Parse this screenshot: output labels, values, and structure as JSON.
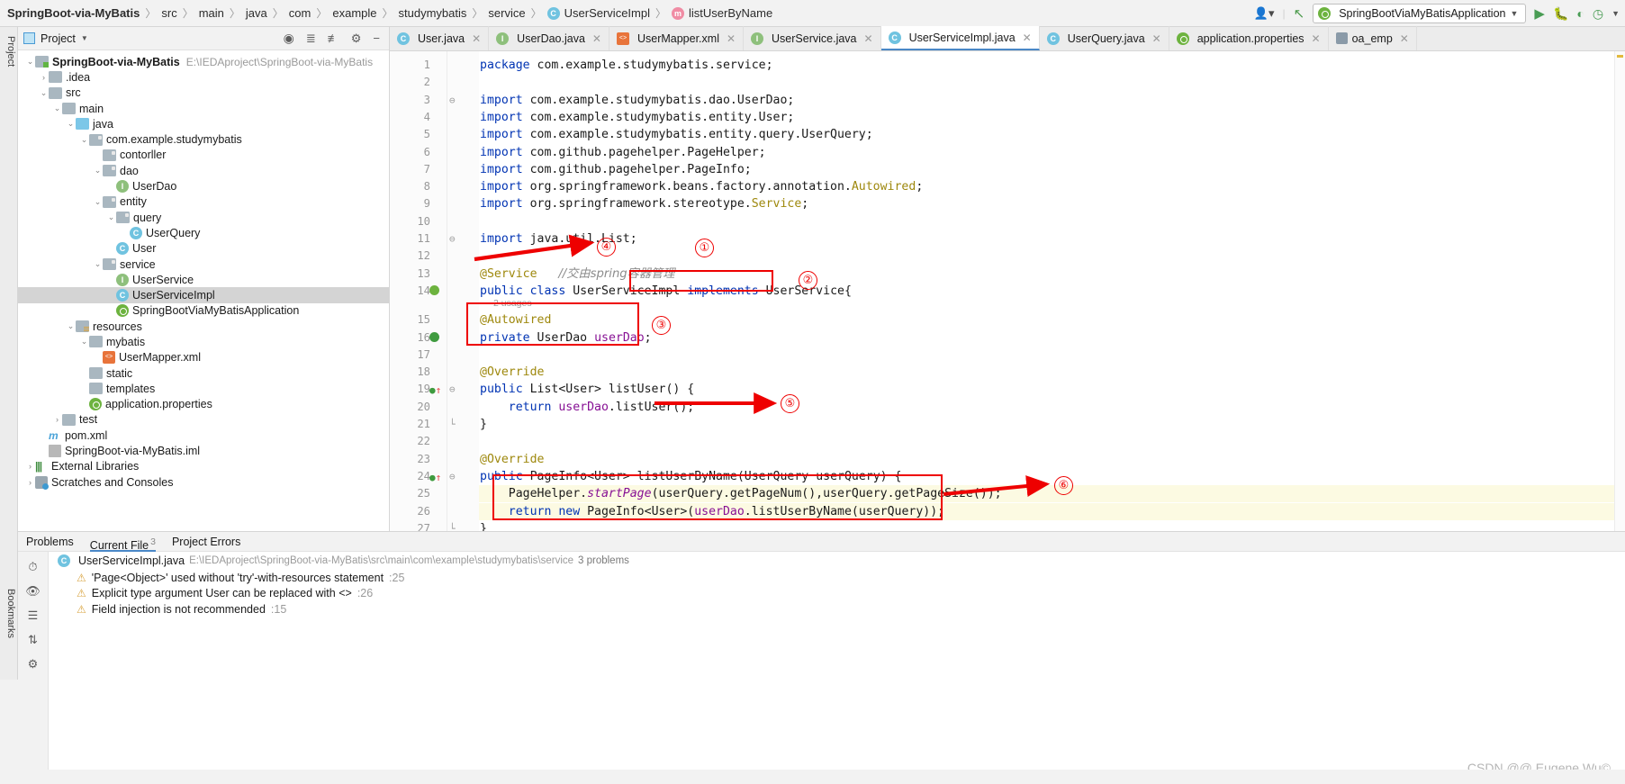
{
  "app": {
    "breadcrumb": [
      {
        "label": "SpringBoot-via-MyBatis",
        "icon": "none",
        "bold": true
      },
      {
        "label": "src",
        "icon": "none",
        "bold": false
      },
      {
        "label": "main",
        "icon": "none",
        "bold": false
      },
      {
        "label": "java",
        "icon": "none",
        "bold": false
      },
      {
        "label": "com",
        "icon": "none",
        "bold": false
      },
      {
        "label": "example",
        "icon": "none",
        "bold": false
      },
      {
        "label": "studymybatis",
        "icon": "none",
        "bold": false
      },
      {
        "label": "service",
        "icon": "none",
        "bold": false
      },
      {
        "label": "UserServiceImpl",
        "icon": "class-badge",
        "bold": false
      },
      {
        "label": "listUserByName",
        "icon": "method-badge",
        "bold": false
      }
    ],
    "toolbar": {
      "profile_icon": "user-icon",
      "back_icon": "arrow-up-left-icon",
      "run_config": "SpringBootViaMyBatisApplication",
      "run_config_icon": "spring-icon",
      "dropdown_icon": "chevron-down-icon",
      "run_icon": "run-triangle-icon",
      "debug_icon": "debug-bug-icon",
      "coverage_icon": "run-with-coverage-icon",
      "profiler_icon": "profiler-icon",
      "more_icon": "chevron-down-icon"
    }
  },
  "left_strip": {
    "project_tab": "Project",
    "bookmarks_tab": "Bookmarks"
  },
  "project_panel": {
    "title": "Project",
    "dropdown_icon": "chevron-down-icon",
    "tools": [
      "locate-icon",
      "expand-all-icon",
      "collapse-all-icon",
      "gear-icon",
      "hide-icon"
    ],
    "tree": [
      {
        "label": "SpringBoot-via-MyBatis",
        "path": "E:\\IEDAproject\\SpringBoot-via-MyBatis",
        "depth": 0,
        "arrow": "down",
        "icon": "module-folder",
        "bold": true,
        "selected": false
      },
      {
        "label": ".idea",
        "path": "",
        "depth": 1,
        "arrow": "right",
        "icon": "folder",
        "bold": false,
        "selected": false
      },
      {
        "label": "src",
        "path": "",
        "depth": 1,
        "arrow": "down",
        "icon": "folder",
        "bold": false,
        "selected": false
      },
      {
        "label": "main",
        "path": "",
        "depth": 2,
        "arrow": "down",
        "icon": "folder",
        "bold": false,
        "selected": false
      },
      {
        "label": "java",
        "path": "",
        "depth": 3,
        "arrow": "down",
        "icon": "source-folder",
        "bold": false,
        "selected": false
      },
      {
        "label": "com.example.studymybatis",
        "path": "",
        "depth": 4,
        "arrow": "down",
        "icon": "package",
        "bold": false,
        "selected": false
      },
      {
        "label": "contorller",
        "path": "",
        "depth": 5,
        "arrow": "none",
        "icon": "package",
        "bold": false,
        "selected": false
      },
      {
        "label": "dao",
        "path": "",
        "depth": 5,
        "arrow": "down",
        "icon": "package",
        "bold": false,
        "selected": false
      },
      {
        "label": "UserDao",
        "path": "",
        "depth": 6,
        "arrow": "none",
        "icon": "interface-badge",
        "bold": false,
        "selected": false
      },
      {
        "label": "entity",
        "path": "",
        "depth": 5,
        "arrow": "down",
        "icon": "package",
        "bold": false,
        "selected": false
      },
      {
        "label": "query",
        "path": "",
        "depth": 6,
        "arrow": "down",
        "icon": "package",
        "bold": false,
        "selected": false
      },
      {
        "label": "UserQuery",
        "path": "",
        "depth": 7,
        "arrow": "none",
        "icon": "class-badge",
        "bold": false,
        "selected": false
      },
      {
        "label": "User",
        "path": "",
        "depth": 6,
        "arrow": "none",
        "icon": "class-badge",
        "bold": false,
        "selected": false
      },
      {
        "label": "service",
        "path": "",
        "depth": 5,
        "arrow": "down",
        "icon": "package",
        "bold": false,
        "selected": false
      },
      {
        "label": "UserService",
        "path": "",
        "depth": 6,
        "arrow": "none",
        "icon": "interface-badge",
        "bold": false,
        "selected": false
      },
      {
        "label": "UserServiceImpl",
        "path": "",
        "depth": 6,
        "arrow": "none",
        "icon": "class-badge",
        "bold": false,
        "selected": true
      },
      {
        "label": "SpringBootViaMyBatisApplication",
        "path": "",
        "depth": 6,
        "arrow": "none",
        "icon": "spring-icon",
        "bold": false,
        "selected": false
      },
      {
        "label": "resources",
        "path": "",
        "depth": 3,
        "arrow": "down",
        "icon": "resource-folder",
        "bold": false,
        "selected": false
      },
      {
        "label": "mybatis",
        "path": "",
        "depth": 4,
        "arrow": "down",
        "icon": "folder",
        "bold": false,
        "selected": false
      },
      {
        "label": "UserMapper.xml",
        "path": "",
        "depth": 5,
        "arrow": "none",
        "icon": "xml-icon",
        "bold": false,
        "selected": false
      },
      {
        "label": "static",
        "path": "",
        "depth": 4,
        "arrow": "none",
        "icon": "folder",
        "bold": false,
        "selected": false
      },
      {
        "label": "templates",
        "path": "",
        "depth": 4,
        "arrow": "none",
        "icon": "folder",
        "bold": false,
        "selected": false
      },
      {
        "label": "application.properties",
        "path": "",
        "depth": 4,
        "arrow": "none",
        "icon": "spring-icon",
        "bold": false,
        "selected": false
      },
      {
        "label": "test",
        "path": "",
        "depth": 2,
        "arrow": "right",
        "icon": "folder",
        "bold": false,
        "selected": false
      },
      {
        "label": "pom.xml",
        "path": "",
        "depth": 1,
        "arrow": "none",
        "icon": "maven-icon",
        "bold": false,
        "selected": false
      },
      {
        "label": "SpringBoot-via-MyBatis.iml",
        "path": "",
        "depth": 1,
        "arrow": "none",
        "icon": "iml-icon",
        "bold": false,
        "selected": false
      },
      {
        "label": "External Libraries",
        "path": "",
        "depth": 0,
        "arrow": "right",
        "icon": "library-icon",
        "bold": false,
        "selected": false
      },
      {
        "label": "Scratches and Consoles",
        "path": "",
        "depth": 0,
        "arrow": "right",
        "icon": "scratches-icon",
        "bold": false,
        "selected": false
      }
    ]
  },
  "editor_tabs": [
    {
      "label": "User.java",
      "icon": "class-badge",
      "active": false
    },
    {
      "label": "UserDao.java",
      "icon": "interface-badge",
      "active": false
    },
    {
      "label": "UserMapper.xml",
      "icon": "xml-icon",
      "active": false
    },
    {
      "label": "UserService.java",
      "icon": "interface-badge",
      "active": false
    },
    {
      "label": "UserServiceImpl.java",
      "icon": "class-badge",
      "active": true
    },
    {
      "label": "UserQuery.java",
      "icon": "class-badge",
      "active": false
    },
    {
      "label": "application.properties",
      "icon": "spring-icon",
      "active": false
    },
    {
      "label": "oa_emp",
      "icon": "db-icon",
      "active": false
    }
  ],
  "code": {
    "lines": [
      {
        "n": "1",
        "tokens": [
          {
            "t": "package ",
            "c": "kw"
          },
          {
            "t": "com.example.studymybatis.service;",
            "c": "cls"
          }
        ]
      },
      {
        "n": "2",
        "tokens": []
      },
      {
        "n": "3",
        "fold": "minus",
        "tokens": [
          {
            "t": "import ",
            "c": "kw"
          },
          {
            "t": "com.example.studymybatis.dao.UserDao;",
            "c": "cls"
          }
        ]
      },
      {
        "n": "4",
        "tokens": [
          {
            "t": "import ",
            "c": "kw"
          },
          {
            "t": "com.example.studymybatis.entity.User;",
            "c": "cls"
          }
        ]
      },
      {
        "n": "5",
        "tokens": [
          {
            "t": "import ",
            "c": "kw"
          },
          {
            "t": "com.example.studymybatis.entity.query.UserQuery;",
            "c": "cls"
          }
        ]
      },
      {
        "n": "6",
        "tokens": [
          {
            "t": "import ",
            "c": "kw"
          },
          {
            "t": "com.github.pagehelper.PageHelper;",
            "c": "cls"
          }
        ]
      },
      {
        "n": "7",
        "tokens": [
          {
            "t": "import ",
            "c": "kw"
          },
          {
            "t": "com.github.pagehelper.PageInfo;",
            "c": "cls"
          }
        ]
      },
      {
        "n": "8",
        "tokens": [
          {
            "t": "import ",
            "c": "kw"
          },
          {
            "t": "org.springframework.beans.factory.annotation.",
            "c": "cls"
          },
          {
            "t": "Autowired",
            "c": "ann"
          },
          {
            "t": ";",
            "c": "cls"
          }
        ]
      },
      {
        "n": "9",
        "tokens": [
          {
            "t": "import ",
            "c": "kw"
          },
          {
            "t": "org.springframework.stereotype.",
            "c": "cls"
          },
          {
            "t": "Service",
            "c": "ann"
          },
          {
            "t": ";",
            "c": "cls"
          }
        ]
      },
      {
        "n": "10",
        "tokens": []
      },
      {
        "n": "11",
        "fold": "minus",
        "tokens": [
          {
            "t": "import ",
            "c": "kw"
          },
          {
            "t": "java.util.List;",
            "c": "cls"
          }
        ]
      },
      {
        "n": "12",
        "tokens": []
      },
      {
        "n": "13",
        "tokens": [
          {
            "t": "@Service",
            "c": "ann"
          },
          {
            "t": "   ",
            "c": "cls"
          },
          {
            "t": "//交由spring容器管理",
            "c": "cmtz"
          }
        ]
      },
      {
        "n": "14",
        "gicon": "spring-bean-icon",
        "tokens": [
          {
            "t": "public class ",
            "c": "kw"
          },
          {
            "t": "UserServiceImpl ",
            "c": "cls"
          },
          {
            "t": "implements ",
            "c": "kw"
          },
          {
            "t": "UserService",
            "c": "cls"
          },
          {
            "t": "{",
            "c": "cls"
          }
        ]
      },
      {
        "n": "",
        "usage": "2 usages"
      },
      {
        "n": "15",
        "tokens": [
          {
            "t": "@Autowired",
            "c": "ann"
          }
        ]
      },
      {
        "n": "16",
        "gicon": "impl-arrow-icon",
        "tokens": [
          {
            "t": "private ",
            "c": "kw"
          },
          {
            "t": "UserDao ",
            "c": "cls"
          },
          {
            "t": "userDao",
            "c": "fld"
          },
          {
            "t": ";",
            "c": "cls"
          }
        ]
      },
      {
        "n": "17",
        "tokens": []
      },
      {
        "n": "18",
        "tokens": [
          {
            "t": "@Override",
            "c": "ann"
          }
        ]
      },
      {
        "n": "19",
        "gicon": "override-icon",
        "fold": "minus",
        "tokens": [
          {
            "t": "public ",
            "c": "kw"
          },
          {
            "t": "List<User> ",
            "c": "cls"
          },
          {
            "t": "listUser",
            "c": "mth"
          },
          {
            "t": "() {",
            "c": "cls"
          }
        ]
      },
      {
        "n": "20",
        "tokens": [
          {
            "t": "    return ",
            "c": "kw"
          },
          {
            "t": "userDao",
            "c": "fld"
          },
          {
            "t": ".listUser();",
            "c": "cls"
          }
        ]
      },
      {
        "n": "21",
        "fold": "end",
        "tokens": [
          {
            "t": "}",
            "c": "cls"
          }
        ]
      },
      {
        "n": "22",
        "tokens": []
      },
      {
        "n": "23",
        "tokens": [
          {
            "t": "@Override",
            "c": "ann"
          }
        ]
      },
      {
        "n": "24",
        "gicon": "override-at-icon",
        "fold": "minus",
        "tokens": [
          {
            "t": "public ",
            "c": "kw"
          },
          {
            "t": "PageInfo<User> ",
            "c": "cls"
          },
          {
            "t": "listUserByName",
            "c": "mth"
          },
          {
            "t": "(",
            "c": "cls"
          },
          {
            "t": "UserQuery ",
            "c": "cls"
          },
          {
            "t": "userQuery",
            "c": "cls"
          },
          {
            "t": ") {",
            "c": "cls"
          }
        ]
      },
      {
        "n": "25",
        "hl": true,
        "tokens": [
          {
            "t": "    PageHelper.",
            "c": "cls"
          },
          {
            "t": "startPage",
            "c": "stat"
          },
          {
            "t": "(userQuery.getPageNum(),userQuery.getPageSize());",
            "c": "cls"
          }
        ]
      },
      {
        "n": "26",
        "hl": true,
        "tokens": [
          {
            "t": "    return new ",
            "c": "kw"
          },
          {
            "t": "PageInfo<",
            "c": "cls"
          },
          {
            "t": "User",
            "c": "cls2"
          },
          {
            "t": ">(",
            "c": "cls"
          },
          {
            "t": "userDao",
            "c": "fld"
          },
          {
            "t": ".listUserByName(userQuery));",
            "c": "cls"
          }
        ]
      },
      {
        "n": "27",
        "fold": "end",
        "tokens": [
          {
            "t": "}",
            "c": "cls"
          }
        ]
      }
    ]
  },
  "annotations": {
    "circles": [
      "①",
      "②",
      "③",
      "④",
      "⑤",
      "⑥"
    ],
    "color": "#ee0000"
  },
  "problems": {
    "tabs": [
      {
        "label": "Problems",
        "count": "",
        "selected": false
      },
      {
        "label": "Current File",
        "count": "3",
        "selected": true
      },
      {
        "label": "Project Errors",
        "count": "",
        "selected": false
      }
    ],
    "strip_icons": [
      "history-icon",
      "eye-icon",
      "list-icon",
      "sort-icon",
      "settings-icon"
    ],
    "file": {
      "icon": "class-badge",
      "name": "UserServiceImpl.java",
      "path": "E:\\IEDAproject\\SpringBoot-via-MyBatis\\src\\main\\com\\example\\studymybatis\\service",
      "count": "3 problems"
    },
    "rows": [
      {
        "icon": "warning-icon",
        "text": "'Page<Object>' used without 'try'-with-resources statement",
        "line": ":25"
      },
      {
        "icon": "warning-icon",
        "text": "Explicit type argument User can be replaced with <>",
        "line": ":26"
      },
      {
        "icon": "warning-icon",
        "text": "Field injection is not recommended",
        "line": ":15"
      }
    ]
  },
  "watermark": "CSDN @@ Eugene Wu©"
}
